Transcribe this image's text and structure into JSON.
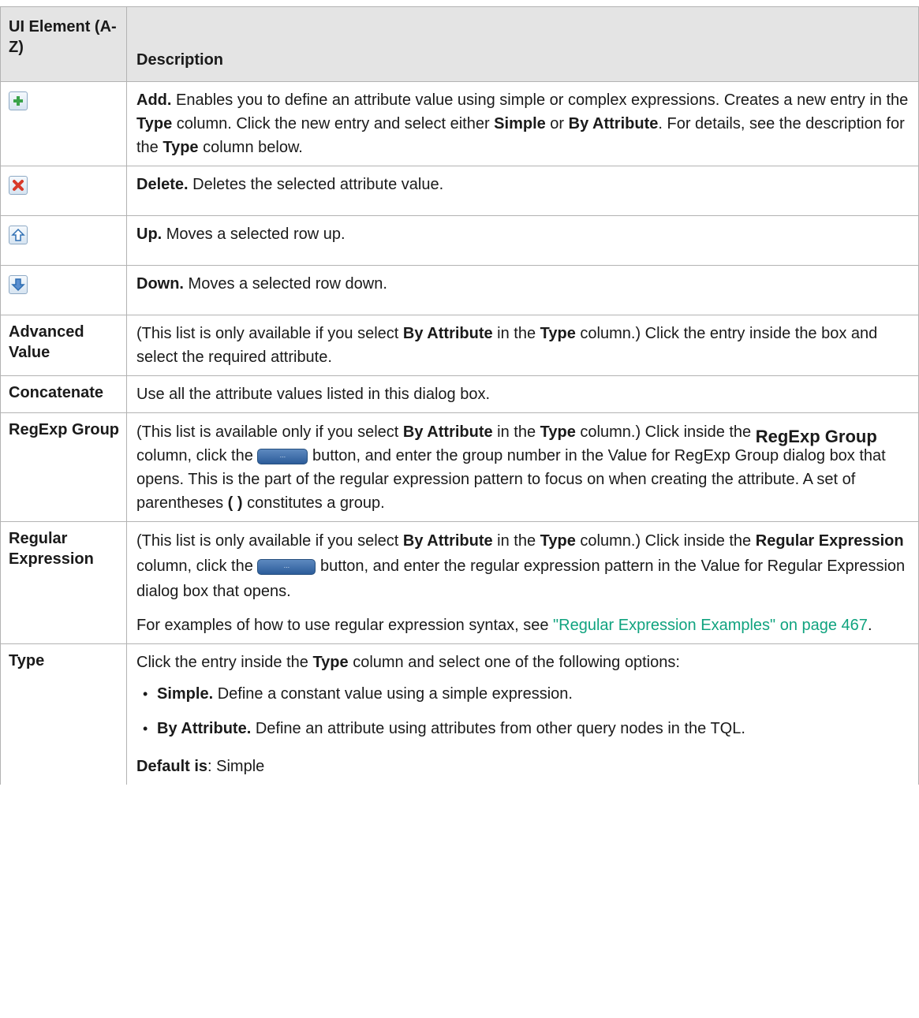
{
  "header": {
    "col1": "UI Element (A-Z)",
    "col2": "Description"
  },
  "rows": {
    "add": {
      "icon": "add-plus-icon",
      "title": "Add.",
      "t1": " Enables you to define an attribute value using simple or complex expressions. Creates a new entry in the ",
      "b1": "Type",
      "t2": " column. Click the new entry and select either ",
      "b2": "Simple",
      "t3": " or ",
      "b3": "By Attribute",
      "t4": ". For details, see the description for the ",
      "b4": "Type",
      "t5": " column below."
    },
    "delete": {
      "icon": "delete-x-icon",
      "title": "Delete.",
      "text": " Deletes the selected attribute value."
    },
    "up": {
      "icon": "arrow-up-icon",
      "title": "Up.",
      "text": " Moves a selected row up."
    },
    "down": {
      "icon": "arrow-down-icon",
      "title": "Down.",
      "text": " Moves a selected row down."
    },
    "advanced": {
      "name": "Advanced Value",
      "t1": "(This list is only available if you select ",
      "b1": "By Attribute",
      "t2": " in the ",
      "b2": "Type",
      "t3": " column.) Click the entry inside the box and select the required attribute."
    },
    "concat": {
      "name": "Concatenate",
      "text": "Use all the attribute values listed in this dialog box."
    },
    "regexp_group": {
      "name": "RegExp Group",
      "t1": "(This list is available only if you select ",
      "b1": "By Attribute",
      "t2": " in the ",
      "b2": "Type",
      "t3": " column.) Click inside the ",
      "b3": "RegExp Group",
      "t4": " column, click the ",
      "btn": "...",
      "t5": " button, and enter the group number in the Value for RegExp Group dialog box that opens. This is the part of the regular expression pattern to focus on when creating the attribute. A set of parentheses ",
      "b4": "( )",
      "t6": " constitutes a group."
    },
    "regular_expression": {
      "name": "Regular Expression",
      "t1": "(This list is only available if you select ",
      "b1": "By Attribute",
      "t2": " in the ",
      "b2": "Type",
      "t3": " column.) Click inside the ",
      "b3": "Regular Expression",
      "t4": " column, click the ",
      "btn": "...",
      "t5": " button, and enter the regular expression pattern in the Value for Regular Expression dialog box that opens.",
      "p2_t1": "For examples of how to use regular expression syntax, see ",
      "p2_link": "\"Regular Expression Examples\" on page 467",
      "p2_t2": "."
    },
    "type": {
      "name": "Type",
      "t1": "Click the entry inside the ",
      "b1": "Type",
      "t2": " column and select one of the following options:",
      "opt1_b": "Simple.",
      "opt1_t": " Define a constant value using a simple expression.",
      "opt2_b": "By Attribute.",
      "opt2_t": " Define an attribute using attributes from other query nodes in the TQL.",
      "default_b": "Default is",
      "default_t": ": Simple"
    }
  }
}
